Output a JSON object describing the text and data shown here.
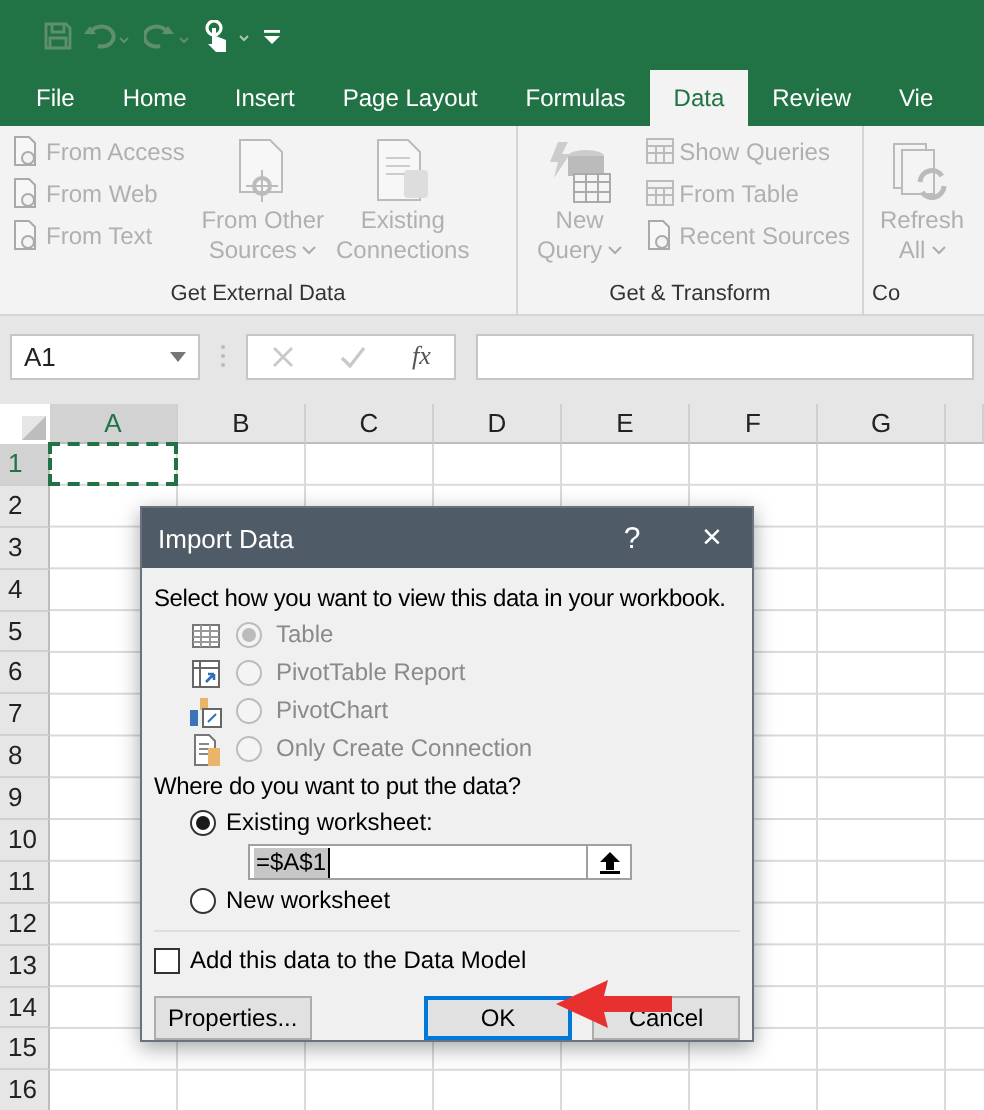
{
  "tabs": [
    {
      "label": "File",
      "selected": false
    },
    {
      "label": "Home",
      "selected": false
    },
    {
      "label": "Insert",
      "selected": false
    },
    {
      "label": "Page Layout",
      "selected": false
    },
    {
      "label": "Formulas",
      "selected": false
    },
    {
      "label": "Data",
      "selected": true
    },
    {
      "label": "Review",
      "selected": false
    },
    {
      "label": "Vie",
      "selected": false
    }
  ],
  "ribbon": {
    "groups": [
      {
        "label": "Get External Data",
        "items": [
          {
            "kind": "small",
            "label": "From Access",
            "disabled": true
          },
          {
            "kind": "small",
            "label": "From Web",
            "disabled": true
          },
          {
            "kind": "small",
            "label": "From Text",
            "disabled": true
          },
          {
            "kind": "large",
            "label": "From Other Sources",
            "has_menu": true,
            "disabled": true
          },
          {
            "kind": "large",
            "label": "Existing Connections",
            "has_menu": false,
            "disabled": true
          }
        ]
      },
      {
        "label": "Get & Transform",
        "items": [
          {
            "kind": "large",
            "label": "New Query",
            "has_menu": true,
            "disabled": true
          },
          {
            "kind": "small",
            "label": "Show Queries",
            "disabled": true
          },
          {
            "kind": "small",
            "label": "From Table",
            "disabled": true
          },
          {
            "kind": "small",
            "label": "Recent Sources",
            "disabled": true
          }
        ]
      },
      {
        "label": "Co",
        "items": [
          {
            "kind": "large",
            "label": "Refresh All",
            "has_menu": true,
            "disabled": true
          }
        ]
      }
    ]
  },
  "formula_bar": {
    "name_box": "A1",
    "function_label": "fx"
  },
  "sheet": {
    "columns": [
      {
        "label": "A",
        "selected": true
      },
      {
        "label": "B",
        "selected": false
      },
      {
        "label": "C",
        "selected": false
      },
      {
        "label": "D",
        "selected": false
      },
      {
        "label": "E",
        "selected": false
      },
      {
        "label": "F",
        "selected": false
      },
      {
        "label": "G",
        "selected": false
      }
    ],
    "rows": [
      {
        "label": "1",
        "selected": true
      },
      {
        "label": "2",
        "selected": false
      },
      {
        "label": "3",
        "selected": false
      },
      {
        "label": "4",
        "selected": false
      },
      {
        "label": "5",
        "selected": false
      },
      {
        "label": "6",
        "selected": false
      },
      {
        "label": "7",
        "selected": false
      },
      {
        "label": "8",
        "selected": false
      },
      {
        "label": "9",
        "selected": false
      },
      {
        "label": "10",
        "selected": false
      },
      {
        "label": "11",
        "selected": false
      },
      {
        "label": "12",
        "selected": false
      },
      {
        "label": "13",
        "selected": false
      },
      {
        "label": "14",
        "selected": false
      },
      {
        "label": "15",
        "selected": false
      },
      {
        "label": "16",
        "selected": false
      }
    ]
  },
  "dialog": {
    "title": "Import Data",
    "help": "?",
    "close": "×",
    "view_prompt": "Select how you want to view this data in your workbook.",
    "view_options": [
      {
        "kind": "table",
        "label": "Table",
        "selected": true,
        "disabled": true
      },
      {
        "kind": "pivottable",
        "label": "PivotTable Report",
        "selected": false,
        "disabled": true
      },
      {
        "kind": "pivotchart",
        "label": "PivotChart",
        "selected": false,
        "disabled": true
      },
      {
        "kind": "connection",
        "label": "Only Create Connection",
        "selected": false,
        "disabled": true
      }
    ],
    "location_prompt": "Where do you want to put the data?",
    "location_options": [
      {
        "label": "Existing worksheet:",
        "selected": true
      },
      {
        "label": "New worksheet",
        "selected": false
      }
    ],
    "range_value": "=$A$1",
    "data_model": {
      "label": "Add this data to the Data Model",
      "checked": false
    },
    "buttons": [
      {
        "kind": "properties",
        "label": "Properties..."
      },
      {
        "kind": "ok",
        "label": "OK"
      },
      {
        "kind": "cancel",
        "label": "Cancel"
      }
    ]
  }
}
